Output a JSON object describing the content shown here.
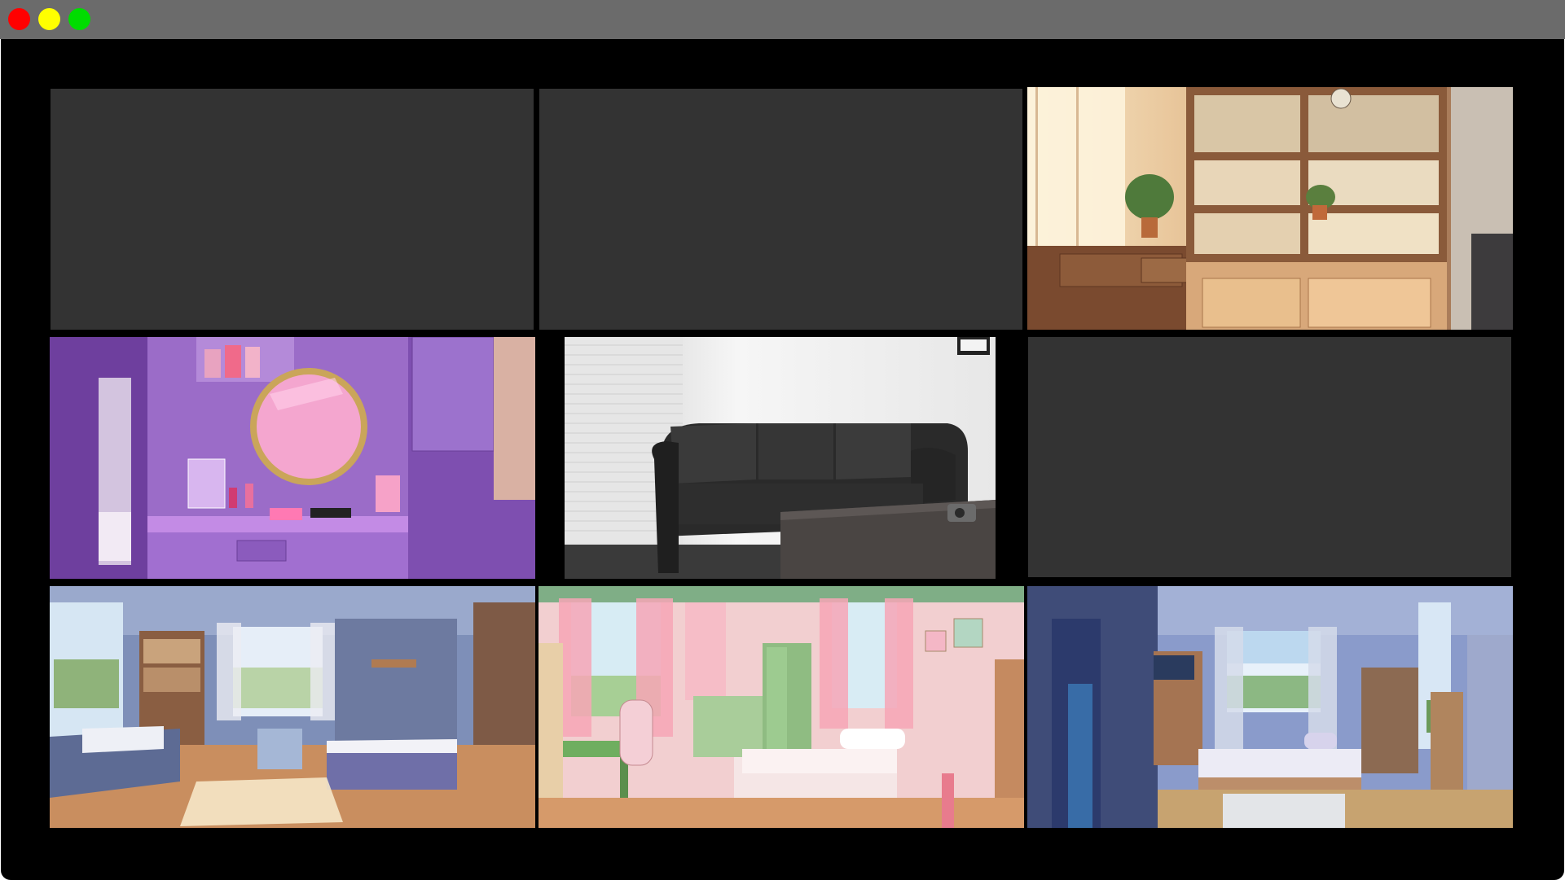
{
  "window": {
    "controls": [
      "close-button",
      "minimize-button",
      "maximize-button"
    ],
    "colors": {
      "close": "#ff0000",
      "minimize": "#ffff00",
      "maximize": "#00dd00",
      "titlebar": "#6b6b6b",
      "stage": "#000000",
      "empty_tile": "#333333"
    }
  },
  "grid": {
    "rows": 3,
    "columns": 3,
    "tiles": [
      {
        "id": "tile-1",
        "kind": "empty"
      },
      {
        "id": "tile-2",
        "kind": "empty"
      },
      {
        "id": "tile-3",
        "kind": "image",
        "subject": "sunlit-bookshelf-room"
      },
      {
        "id": "tile-4",
        "kind": "image",
        "subject": "purple-vanity-room"
      },
      {
        "id": "tile-5",
        "kind": "image",
        "subject": "black-leather-sofa-room"
      },
      {
        "id": "tile-6",
        "kind": "empty"
      },
      {
        "id": "tile-7",
        "kind": "image",
        "subject": "blue-bedroom-with-bunk"
      },
      {
        "id": "tile-8",
        "kind": "image",
        "subject": "pink-bedroom"
      },
      {
        "id": "tile-9",
        "kind": "image",
        "subject": "blue-bedroom-with-window"
      }
    ]
  }
}
